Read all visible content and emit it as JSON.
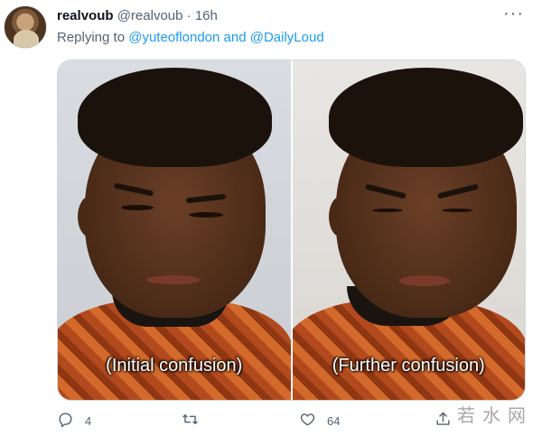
{
  "tweet": {
    "display_name": "realvoub",
    "handle": "@realvoub",
    "separator": "·",
    "time": "16h",
    "replying_prefix": "Replying to",
    "mention_1": "@yuteoflondon",
    "and_word": "and",
    "mention_2": "@DailyLoud",
    "more_symbol": "···"
  },
  "media": {
    "left_caption": "(Initial confusion)",
    "right_caption": "(Further confusion)"
  },
  "actions": {
    "reply_icon": "speech-bubble-icon",
    "reply_count": "4",
    "retweet_icon": "retweet-icon",
    "retweet_count": "",
    "like_icon": "heart-icon",
    "like_count": "64",
    "share_icon": "share-icon"
  },
  "watermark": {
    "text": "若水网"
  },
  "colors": {
    "link": "#1d9bf0",
    "muted": "#536471",
    "text": "#0f1419"
  }
}
